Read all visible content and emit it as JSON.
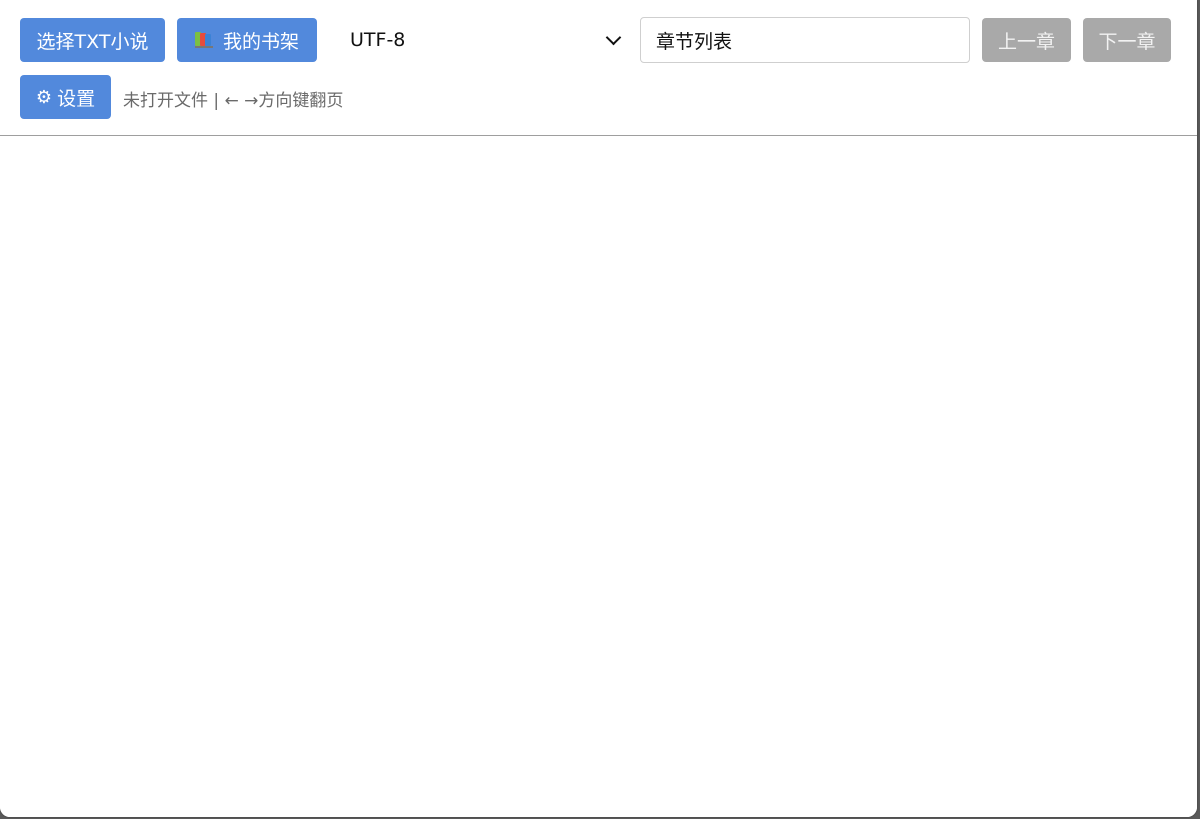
{
  "toolbar": {
    "open_label": "选择TXT小说",
    "shelf_label": "我的书架",
    "encoding_value": "UTF-8",
    "chapter_placeholder": "章节列表",
    "prev_label": "上一章",
    "next_label": "下一章",
    "settings_icon": "⚙",
    "settings_label": "设置"
  },
  "status": {
    "text": "未打开文件 | ← →方向键翻页"
  },
  "icons": {
    "shelf_icon": "books-icon",
    "settings_icon": "gear-icon",
    "encoding_icon": "chevron-down-icon"
  },
  "colors": {
    "primary": "#5289dc",
    "disabled": "#a9a9a9",
    "status_text": "#6a6a6a"
  }
}
